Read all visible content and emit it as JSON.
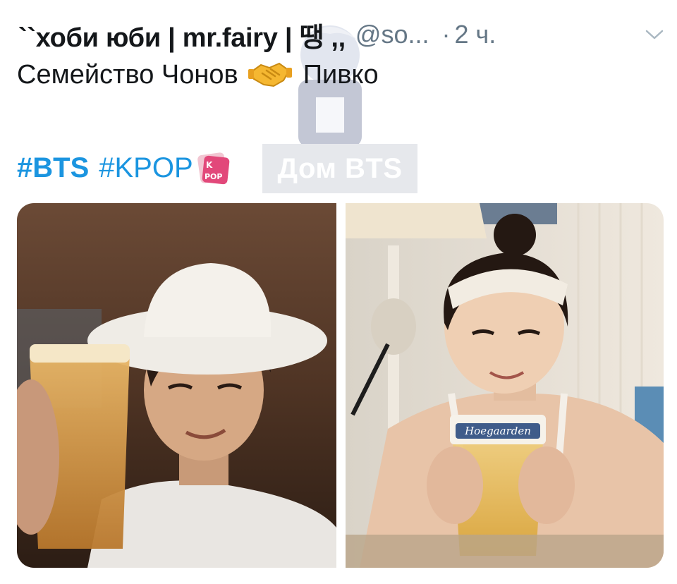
{
  "tweet": {
    "author_name": "``хоби юби | mr.fairy | 땡 ,,",
    "author_handle": "@so...",
    "separator": "·",
    "timestamp": "2 ч.",
    "text_before": "Семейство Чонов",
    "text_after": "Пивко",
    "handshake_icon": "handshake-emoji",
    "hashtags": [
      "#BTS",
      "#KPOP"
    ],
    "kpop_icon": "kpop-emoji",
    "watermark_label": "Дом BTS",
    "photo_right_glass_text": "Hoegaarden"
  },
  "colors": {
    "text_primary": "#14171a",
    "text_secondary": "#657786",
    "link": "#1b95e0",
    "watermark_bg": "#e6e8ec"
  }
}
